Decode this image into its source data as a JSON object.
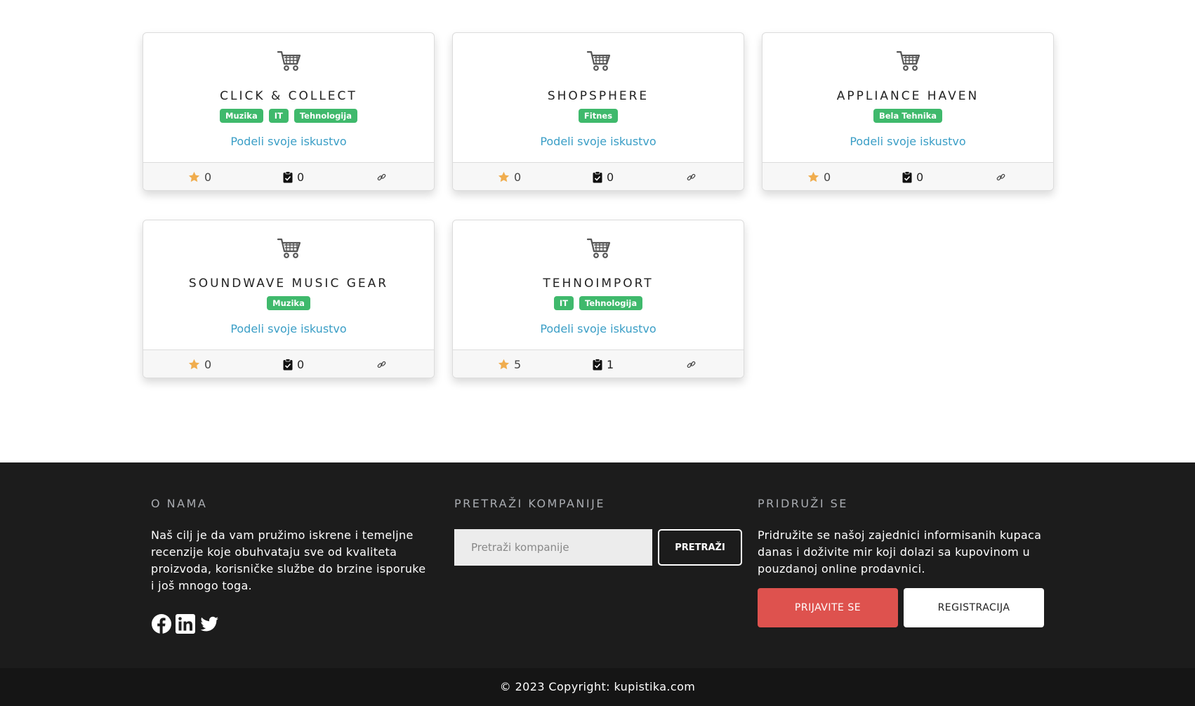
{
  "companies": [
    {
      "name": "CLICK & COLLECT",
      "tags": [
        "Muzika",
        "IT",
        "Tehnologija"
      ],
      "share_label": "Podeli svoje iskustvo",
      "rating": "0",
      "reviews": "0"
    },
    {
      "name": "SHOPSPHERE",
      "tags": [
        "Fitnes"
      ],
      "share_label": "Podeli svoje iskustvo",
      "rating": "0",
      "reviews": "0"
    },
    {
      "name": "APPLIANCE HAVEN",
      "tags": [
        "Bela Tehnika"
      ],
      "share_label": "Podeli svoje iskustvo",
      "rating": "0",
      "reviews": "0"
    },
    {
      "name": "SOUNDWAVE MUSIC GEAR",
      "tags": [
        "Muzika"
      ],
      "share_label": "Podeli svoje iskustvo",
      "rating": "0",
      "reviews": "0"
    },
    {
      "name": "TEHNOIMPORT",
      "tags": [
        "IT",
        "Tehnologija"
      ],
      "share_label": "Podeli svoje iskustvo",
      "rating": "5",
      "reviews": "1"
    }
  ],
  "icons": {
    "card": "shopping-cart-icon",
    "rating": "star-icon",
    "reviews": "clipboard-check-icon",
    "link": "link-icon"
  },
  "colors": {
    "tag": "#3fb96c",
    "link": "#3a9ec6",
    "star": "#f0ad4e",
    "footer_bg": "#1c1c1c",
    "login": "#de524e"
  },
  "footer": {
    "about": {
      "heading": "O NAMA",
      "text": "Naš cilj je da vam pružimo iskrene i temeljne recenzije koje obuhvataju sve od kvaliteta proizvoda, korisničke službe do brzine isporuke i još mnogo toga."
    },
    "search": {
      "heading": "PRETRAŽI KOMPANIJE",
      "placeholder": "Pretraži kompanije",
      "button": "PRETRAŽI"
    },
    "join": {
      "heading": "PRIDRUŽI SE",
      "text": "Pridružite se našoj zajednici informisanih kupaca danas i doživite mir koji dolazi sa kupovinom u pouzdanoj online prodavnici.",
      "login_button": "PRIJAVITE SE",
      "register_button": "REGISTRACIJA"
    },
    "socials": [
      "facebook-icon",
      "linkedin-icon",
      "twitter-icon"
    ],
    "copyright": "© 2023 Copyright: kupistika.com"
  }
}
